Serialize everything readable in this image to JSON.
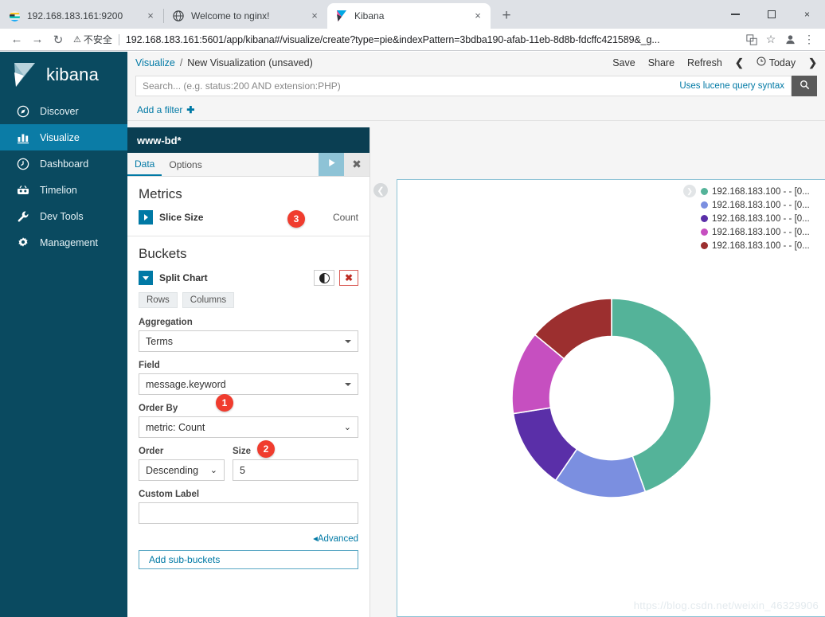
{
  "browser": {
    "tabs": [
      {
        "title": "192.168.183.161:9200",
        "favicon": "elasticsearch-icon",
        "close_label": "×",
        "active": false
      },
      {
        "title": "Welcome to nginx!",
        "favicon": "globe-icon",
        "close_label": "×",
        "active": false
      },
      {
        "title": "Kibana",
        "favicon": "kibana-icon",
        "close_label": "×",
        "active": true
      }
    ],
    "new_tab_label": "+",
    "window_controls": {
      "minimize": "minimize-icon",
      "maximize": "maximize-icon",
      "close": "×"
    },
    "nav": {
      "back": "←",
      "forward": "→",
      "reload": "↻"
    },
    "security_label": "不安全",
    "security_icon": "warning-triangle-icon",
    "url": "192.168.183.161:5601/app/kibana#/visualize/create?type=pie&indexPattern=3bdba190-afab-11eb-8d8b-fdcffc421589&_g...",
    "omnibar_icons": {
      "translate": "translate-icon",
      "bookmark": "star-icon",
      "profile": "profile-icon",
      "menu": "kebab-menu-icon"
    }
  },
  "sidebar": {
    "brand": "kibana",
    "brand_icon": "kibana-logo-icon",
    "items": [
      {
        "label": "Discover",
        "icon": "compass-icon",
        "active": false
      },
      {
        "label": "Visualize",
        "icon": "bar-chart-icon",
        "active": true
      },
      {
        "label": "Dashboard",
        "icon": "dashboard-clock-icon",
        "active": false
      },
      {
        "label": "Timelion",
        "icon": "timelion-icon",
        "active": false
      },
      {
        "label": "Dev Tools",
        "icon": "wrench-icon",
        "active": false
      },
      {
        "label": "Management",
        "icon": "gear-icon",
        "active": false
      }
    ]
  },
  "topbar": {
    "breadcrumb_root": "Visualize",
    "breadcrumb_sep": "/",
    "breadcrumb_current": "New Visualization (unsaved)",
    "save_label": "Save",
    "share_label": "Share",
    "refresh_label": "Refresh",
    "prev_icon": "❮",
    "next_icon": "❯",
    "time_icon": "clock-icon",
    "time_label": "Today"
  },
  "query": {
    "placeholder": "Search... (e.g. status:200 AND extension:PHP)",
    "value": "",
    "hint": "Uses lucene query syntax",
    "search_icon": "magnifier-icon"
  },
  "filter_bar": {
    "label": "Add a filter",
    "plus": "✚"
  },
  "editor": {
    "index_pattern": "www-bd*",
    "tabs": [
      {
        "label": "Data",
        "active": true
      },
      {
        "label": "Options",
        "active": false
      }
    ],
    "apply_icon": "play-icon",
    "cancel_icon": "✖",
    "metrics": {
      "title": "Metrics",
      "slice_label": "Slice Size",
      "slice_value": "Count",
      "expand_icon": "triangle-right-icon"
    },
    "buckets": {
      "title": "Buckets",
      "split_label": "Split Chart",
      "collapse_icon": "triangle-down-icon",
      "toggle_icon": "contrast-toggle-icon",
      "delete_icon": "✖",
      "pills": [
        "Rows",
        "Columns"
      ],
      "aggregation_label": "Aggregation",
      "aggregation_value": "Terms",
      "field_label": "Field",
      "field_value": "message.keyword",
      "order_by_label": "Order By",
      "order_by_value": "metric: Count",
      "order_label": "Order",
      "order_value": "Descending",
      "size_label": "Size",
      "size_value": "5",
      "custom_label_label": "Custom Label",
      "custom_label_value": "",
      "advanced_label": "Advanced",
      "advanced_caret": "◂",
      "add_sub_buckets": "Add sub-buckets"
    }
  },
  "badges": [
    {
      "number": "1",
      "target": "aggregation-select"
    },
    {
      "number": "2",
      "target": "field-select"
    },
    {
      "number": "3",
      "target": "apply-changes-button"
    }
  ],
  "chart_panel": {
    "collapse_icon": "❮",
    "legend_toggle_icon": "❯",
    "watermark": "https://blog.csdn.net/weixin_46329906"
  },
  "chart_data": {
    "type": "pie",
    "variant": "donut",
    "title": "",
    "legend_position": "right",
    "labels": [
      "192.168.183.100 - - [0...",
      "192.168.183.100 - - [0...",
      "192.168.183.100 - - [0...",
      "192.168.183.100 - - [0...",
      "192.168.183.100 - - [0..."
    ],
    "colors": [
      "#54b399",
      "#7b8fe0",
      "#6a3fb5",
      "#c martial",
      "#9c2f2f"
    ],
    "slice_colors": [
      "#54b399",
      "#7b8fe0",
      "#6d3fb5",
      "#c martial",
      "#9c2f2f"
    ],
    "values": [
      44.5,
      15.0,
      13.0,
      13.5,
      14.0
    ],
    "start_angle_deg": 0,
    "inner_radius_ratio": 0.62
  }
}
